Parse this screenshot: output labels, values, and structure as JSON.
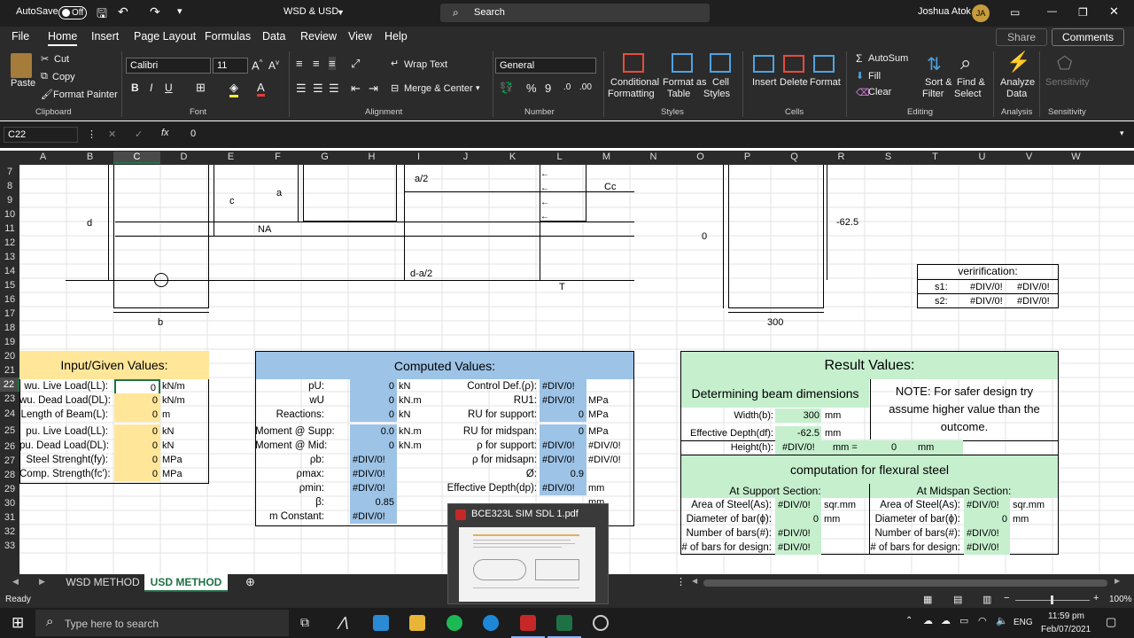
{
  "titlebar": {
    "autosave_label": "AutoSave",
    "autosave_state": "Off",
    "doc_title": "WSD & USD",
    "search_placeholder": "Search",
    "user_name": "Joshua Atok",
    "user_initials": "JA"
  },
  "menu": {
    "items": [
      "File",
      "Home",
      "Insert",
      "Page Layout",
      "Formulas",
      "Data",
      "Review",
      "View",
      "Help"
    ],
    "active": "Home",
    "share": "Share",
    "comments": "Comments"
  },
  "ribbon": {
    "clipboard": {
      "paste": "Paste",
      "cut": "Cut",
      "copy": "Copy",
      "format_painter": "Format Painter",
      "group": "Clipboard"
    },
    "font": {
      "family": "Calibri",
      "size": "11",
      "group": "Font"
    },
    "alignment": {
      "wrap": "Wrap Text",
      "merge": "Merge & Center",
      "group": "Alignment"
    },
    "number": {
      "format": "General",
      "group": "Number"
    },
    "styles": {
      "cond_line1": "Conditional",
      "cond_line2": "Formatting",
      "table_line1": "Format as",
      "table_line2": "Table",
      "cell_line1": "Cell",
      "cell_line2": "Styles",
      "group": "Styles"
    },
    "cells": {
      "insert": "Insert",
      "delete": "Delete",
      "format": "Format",
      "group": "Cells"
    },
    "editing": {
      "autosum": "AutoSum",
      "fill": "Fill",
      "clear": "Clear",
      "sort_line1": "Sort &",
      "sort_line2": "Filter",
      "find_line1": "Find &",
      "find_line2": "Select",
      "group": "Editing"
    },
    "analysis": {
      "line1": "Analyze",
      "line2": "Data",
      "group": "Analysis"
    },
    "sensitivity": {
      "label": "Sensitivity",
      "group": "Sensitivity"
    }
  },
  "formula_bar": {
    "name_box": "C22",
    "formula": "0",
    "fx": "fx"
  },
  "columns": [
    "A",
    "B",
    "C",
    "D",
    "E",
    "F",
    "G",
    "H",
    "I",
    "J",
    "K",
    "L",
    "M",
    "N",
    "O",
    "P",
    "Q",
    "R",
    "S",
    "T",
    "U",
    "V",
    "W"
  ],
  "rows": [
    "7",
    "8",
    "9",
    "10",
    "11",
    "12",
    "13",
    "14",
    "15",
    "16",
    "17",
    "18",
    "19",
    "20",
    "21",
    "22",
    "23",
    "24",
    "25",
    "26",
    "27",
    "28",
    "29",
    "30",
    "31",
    "32",
    "33"
  ],
  "diagram": {
    "d": "d",
    "c": "c",
    "a": "a",
    "a2": "a/2",
    "cc": "Cc",
    "na": "NA",
    "da2": "d-a/2",
    "t": "T",
    "b": "b",
    "zero": "0",
    "neg": "-62.5",
    "w300": "300"
  },
  "verification": {
    "title": "verirification:",
    "s1": "s1:",
    "s2": "s2:",
    "v1": "#DIV/0!",
    "v2": "#DIV/0!",
    "v3": "#DIV/0!",
    "v4": "#DIV/0!"
  },
  "input": {
    "title": "Input/Given Values:",
    "rows": [
      {
        "label": "wu. Live Load(LL):",
        "value": "0",
        "unit": "kN/m"
      },
      {
        "label": "wu. Dead Load(DL):",
        "value": "0",
        "unit": "kN/m"
      },
      {
        "label": "Length of Beam(L):",
        "value": "0",
        "unit": "m"
      },
      {
        "label": "pu. Live Load(LL):",
        "value": "0",
        "unit": "kN"
      },
      {
        "label": "pu. Dead Load(DL):",
        "value": "0",
        "unit": "kN"
      },
      {
        "label": "Steel Strenght(fy):",
        "value": "0",
        "unit": "MPa"
      },
      {
        "label": "Comp. Strength(fc'):",
        "value": "0",
        "unit": "MPa"
      }
    ]
  },
  "computed": {
    "title": "Computed Values:",
    "left": [
      {
        "label": "pU:",
        "value": "0",
        "unit": "kN"
      },
      {
        "label": "wU",
        "value": "0",
        "unit": "kN.m"
      },
      {
        "label": "Reactions:",
        "value": "0",
        "unit": "kN"
      },
      {
        "label": "Moment @ Supp:",
        "value": "0.0",
        "unit": "kN.m"
      },
      {
        "label": "Moment @ Mid:",
        "value": "0",
        "unit": "kN.m"
      },
      {
        "label": "ρb:",
        "value": "#DIV/0!",
        "unit": ""
      },
      {
        "label": "ρmax:",
        "value": "#DIV/0!",
        "unit": ""
      },
      {
        "label": "ρmin:",
        "value": "#DIV/0!",
        "unit": ""
      },
      {
        "label": "β:",
        "value": "0.85",
        "unit": ""
      },
      {
        "label": "m Constant:",
        "value": "#DIV/0!",
        "unit": ""
      }
    ],
    "right": [
      {
        "label": "Control Def.(ρ):",
        "value": "#DIV/0!",
        "unit": ""
      },
      {
        "label": "RU1:",
        "value": "#DIV/0!",
        "unit": "MPa"
      },
      {
        "label": "RU for support:",
        "value": "0",
        "unit": "MPa"
      },
      {
        "label": "RU for midspan:",
        "value": "0",
        "unit": "MPa"
      },
      {
        "label": "ρ for support:",
        "value": "#DIV/0!",
        "unit": "#DIV/0!"
      },
      {
        "label": "ρ for midsapn:",
        "value": "#DIV/0!",
        "unit": "#DIV/0!"
      },
      {
        "label": "Ø:",
        "value": "0.9",
        "unit": ""
      },
      {
        "label": "Effective Depth(dp):",
        "value": "#DIV/0!",
        "unit": "mm"
      },
      {
        "label": "",
        "value": "",
        "unit": "mm"
      },
      {
        "label": "",
        "value": "",
        "unit": "mm"
      }
    ]
  },
  "result": {
    "title": "Result Values:",
    "dim_title": "Determining beam dimensions",
    "width_label": "Width(b):",
    "width_value": "300",
    "width_unit": "mm",
    "eff_label": "Effective Depth(df):",
    "eff_value": "-62.5",
    "eff_unit": "mm",
    "height_label": "Height(h):",
    "height_value": "#DIV/0!",
    "height_mm1": "mm =",
    "height_zero": "0",
    "height_mm2": "mm",
    "note": "NOTE: For safer design try assume higher value than the outcome.",
    "flex_title": "computation for flexural steel",
    "support_title": "At Support Section:",
    "midspan_title": "At Midspan Section:",
    "support": [
      {
        "label": "Area of Steel(As):",
        "value": "#DIV/0!",
        "unit": "sqr.mm"
      },
      {
        "label": "Diameter of bar(ɸ):",
        "value": "0",
        "unit": "mm"
      },
      {
        "label": "Number of bars(#):",
        "value": "#DIV/0!",
        "unit": ""
      },
      {
        "label": "# of bars for design:",
        "value": "#DIV/0!",
        "unit": ""
      }
    ],
    "midspan": [
      {
        "label": "Area of Steel(As):",
        "value": "#DIV/0!",
        "unit": "sqr.mm"
      },
      {
        "label": "Diameter of bar(ɸ):",
        "value": "0",
        "unit": "mm"
      },
      {
        "label": "Number of bars(#):",
        "value": "#DIV/0!",
        "unit": ""
      },
      {
        "label": "# of bars for design:",
        "value": "#DIV/0!",
        "unit": ""
      }
    ]
  },
  "tabs": {
    "tab1": "WSD METHOD",
    "tab2": "USD METHOD"
  },
  "status": {
    "ready": "Ready",
    "zoom": "100%"
  },
  "popup": {
    "title": "BCE323L SIM SDL 1.pdf"
  },
  "taskbar": {
    "search": "Type here to search",
    "lang": "ENG",
    "time": "11:59 pm",
    "date": "Feb/07/2021"
  }
}
